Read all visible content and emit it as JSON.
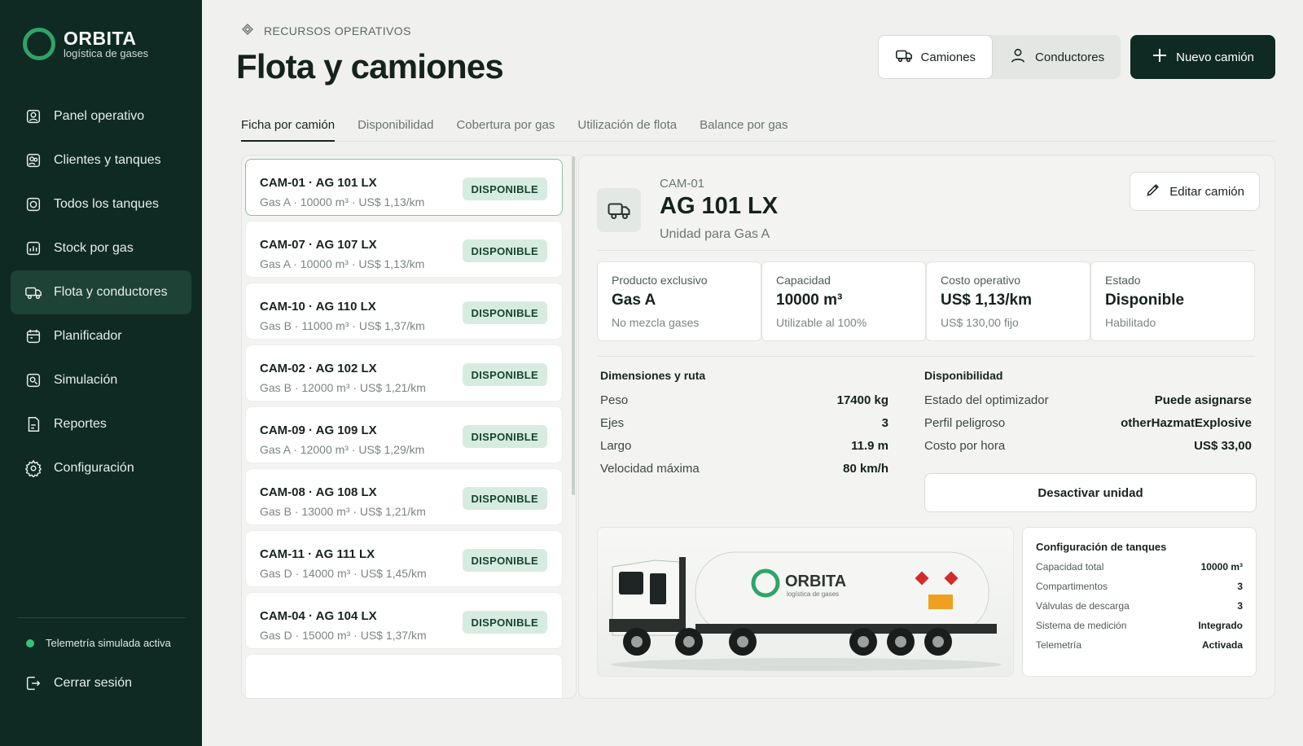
{
  "brand": {
    "name": "ORBITA",
    "subtitle": "logística de gases"
  },
  "sidebar": {
    "items": [
      {
        "label": "Panel operativo",
        "icon": "dashboard-icon"
      },
      {
        "label": "Clientes y tanques",
        "icon": "clients-icon"
      },
      {
        "label": "Todos los tanques",
        "icon": "tanks-icon"
      },
      {
        "label": "Stock por gas",
        "icon": "stock-icon"
      },
      {
        "label": "Flota y conductores",
        "icon": "fleet-icon",
        "active": true
      },
      {
        "label": "Planificador",
        "icon": "calendar-icon"
      },
      {
        "label": "Simulación",
        "icon": "simulation-icon"
      },
      {
        "label": "Reportes",
        "icon": "reports-icon"
      },
      {
        "label": "Configuración",
        "icon": "gear-icon"
      }
    ],
    "telemetry": "Telemetría simulada activa",
    "logout": "Cerrar sesión"
  },
  "header": {
    "breadcrumb": "RECURSOS OPERATIVOS",
    "title": "Flota y camiones",
    "btn_trucks": "Camiones",
    "btn_drivers": "Conductores",
    "btn_new": "Nuevo camión"
  },
  "tabs": [
    {
      "label": "Ficha por camión",
      "active": true
    },
    {
      "label": "Disponibilidad"
    },
    {
      "label": "Cobertura por gas"
    },
    {
      "label": "Utilización de flota"
    },
    {
      "label": "Balance por gas"
    }
  ],
  "trucks": [
    {
      "title": "CAM-01 · AG 101 LX",
      "sub": "Gas A · 10000 m³ · US$ 1,13/km",
      "status": "DISPONIBLE"
    },
    {
      "title": "CAM-07 · AG 107 LX",
      "sub": "Gas A · 10000 m³ · US$ 1,13/km",
      "status": "DISPONIBLE"
    },
    {
      "title": "CAM-10 · AG 110 LX",
      "sub": "Gas B · 11000 m³ · US$ 1,37/km",
      "status": "DISPONIBLE"
    },
    {
      "title": "CAM-02 · AG 102 LX",
      "sub": "Gas B · 12000 m³ · US$ 1,21/km",
      "status": "DISPONIBLE"
    },
    {
      "title": "CAM-09 · AG 109 LX",
      "sub": "Gas A · 12000 m³ · US$ 1,29/km",
      "status": "DISPONIBLE"
    },
    {
      "title": "CAM-08 · AG 108 LX",
      "sub": "Gas B · 13000 m³ · US$ 1,21/km",
      "status": "DISPONIBLE"
    },
    {
      "title": "CAM-11 · AG 111 LX",
      "sub": "Gas D · 14000 m³ · US$ 1,45/km",
      "status": "DISPONIBLE"
    },
    {
      "title": "CAM-04 · AG 104 LX",
      "sub": "Gas D · 15000 m³ · US$ 1,37/km",
      "status": "DISPONIBLE"
    }
  ],
  "detail": {
    "code": "CAM-01",
    "plate": "AG 101 LX",
    "unit": "Unidad para Gas A",
    "edit": "Editar camión",
    "stats": [
      {
        "label": "Producto exclusivo",
        "value": "Gas A",
        "note": "No mezcla gases"
      },
      {
        "label": "Capacidad",
        "value": "10000 m³",
        "note": "Utilizable al 100%"
      },
      {
        "label": "Costo operativo",
        "value": "US$ 1,13/km",
        "note": "US$ 130,00 fijo"
      },
      {
        "label": "Estado",
        "value": "Disponible",
        "note": "Habilitado"
      }
    ],
    "dimensions": {
      "title": "Dimensiones y ruta",
      "rows": [
        {
          "k": "Peso",
          "v": "17400 kg"
        },
        {
          "k": "Ejes",
          "v": "3"
        },
        {
          "k": "Largo",
          "v": "11.9 m"
        },
        {
          "k": "Velocidad máxima",
          "v": "80 km/h"
        }
      ]
    },
    "availability": {
      "title": "Disponibilidad",
      "rows": [
        {
          "k": "Estado del optimizador",
          "v": "Puede asignarse"
        },
        {
          "k": "Perfil peligroso",
          "v": "otherHazmatExplosive"
        },
        {
          "k": "Costo por hora",
          "v": "US$ 33,00"
        }
      ],
      "deactivate": "Desactivar unidad"
    },
    "tank_config": {
      "title": "Configuración de tanques",
      "rows": [
        {
          "k": "Capacidad total",
          "v": "10000 m³"
        },
        {
          "k": "Compartimentos",
          "v": "3"
        },
        {
          "k": "Válvulas de descarga",
          "v": "3"
        },
        {
          "k": "Sistema de medición",
          "v": "Integrado"
        },
        {
          "k": "Telemetría",
          "v": "Activada"
        }
      ]
    }
  },
  "colors": {
    "sidebar": "#0f2a22",
    "accent": "#2fa36b",
    "badge": "#d7ece0"
  }
}
